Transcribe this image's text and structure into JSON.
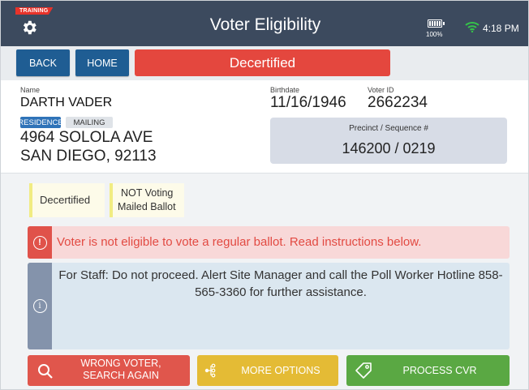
{
  "header": {
    "training_badge": "TRAINING",
    "title": "Voter Eligibility",
    "battery_percent": "100%",
    "time": "4:18 PM",
    "icons": [
      "gear-icon",
      "battery-icon",
      "wifi-icon"
    ]
  },
  "nav": {
    "back_label": "BACK",
    "home_label": "HOME",
    "status_banner": "Decertified"
  },
  "voter": {
    "name_label": "Name",
    "name": "DARTH VADER",
    "birthdate_label": "Birthdate",
    "birthdate": "11/16/1946",
    "voter_id_label": "Voter ID",
    "voter_id": "2662234",
    "address_tabs": [
      "RESIDENCE",
      "MAILING"
    ],
    "address_line1": "4964 SOLOLA AVE",
    "address_line2": "SAN DIEGO, 92113",
    "precinct_label": "Precinct / Sequence #",
    "precinct_value": "146200 / 0219"
  },
  "status": {
    "pill_decertified": "Decertified",
    "pill_voting_line1": "NOT Voting",
    "pill_voting_line2": "Mailed Ballot",
    "alert_text": "Voter is not eligible to vote a regular ballot.  Read instructions below.",
    "info_text": "For Staff: Do not proceed. Alert Site Manager and call the Poll Worker Hotline 858-565-3360 for further assistance."
  },
  "actions": {
    "wrong_voter_line1": "WRONG VOTER,",
    "wrong_voter_line2": "SEARCH AGAIN",
    "more_options": "MORE OPTIONS",
    "process_cvr": "PROCESS CVR"
  },
  "colors": {
    "header_bg": "#3c4a5e",
    "nav_button": "#1f5d93",
    "status_red": "#e4473e",
    "action_red": "#e0564c",
    "action_yellow": "#e4bb35",
    "action_green": "#5aa843",
    "info_bg": "#dbe7f0",
    "alert_bg": "#f8d8d8"
  }
}
